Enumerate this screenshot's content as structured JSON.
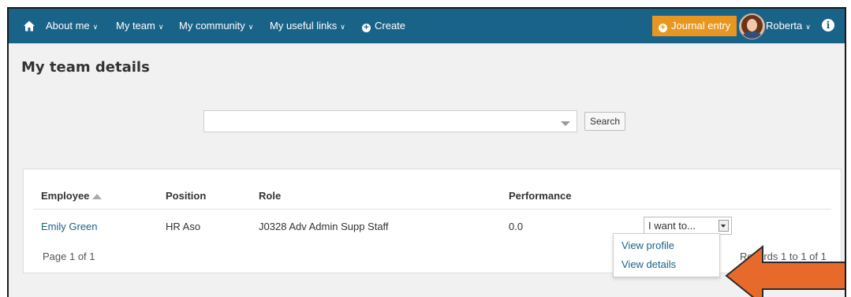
{
  "nav": {
    "items": [
      {
        "label": "About me"
      },
      {
        "label": "My team"
      },
      {
        "label": "My community"
      },
      {
        "label": "My useful links"
      }
    ],
    "create_label": "Create",
    "journal_label": "Journal entry",
    "user_label": "Roberta"
  },
  "page": {
    "title": "My team details"
  },
  "search": {
    "placeholder": "",
    "button_label": "Search"
  },
  "table": {
    "columns": [
      "Employee",
      "Position",
      "Role",
      "Performance"
    ],
    "rows": [
      {
        "employee": "Emily Green",
        "position": "HR Aso",
        "role": "J0328 Adv Admin Supp Staff",
        "performance": "0.0",
        "action": "I want to..."
      }
    ],
    "page_info": "Page 1 of 1",
    "records_info": "Records 1 to 1 of 1"
  },
  "action_menu": {
    "items": [
      "View profile",
      "View details"
    ]
  },
  "colors": {
    "nav_bg": "#1a6388",
    "journal_bg": "#e8961f",
    "arrow": "#e86a2a",
    "link": "#1a6388"
  }
}
